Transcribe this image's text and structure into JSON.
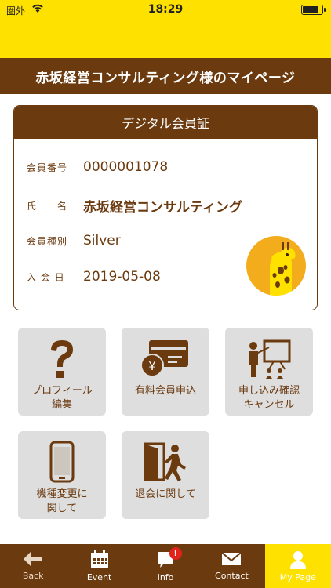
{
  "status_bar": {
    "carrier": "圏外",
    "time": "18:29"
  },
  "header": {
    "title": "赤坂経営コンサルティング様のマイページ"
  },
  "card": {
    "title": "デジタル会員証",
    "rows": [
      {
        "label": "会員番号",
        "value": "0000001078"
      },
      {
        "label": "氏　　名",
        "value": "赤坂経営コンサルティング"
      },
      {
        "label": "会員種別",
        "value": "Silver"
      },
      {
        "label": "入 会 日",
        "value": "2019-05-08"
      }
    ]
  },
  "tiles": [
    {
      "label": "プロフィール\n編集",
      "icon": "question-icon"
    },
    {
      "label": "有料会員申込",
      "icon": "yen-card-icon"
    },
    {
      "label": "申し込み確認\nキャンセル",
      "icon": "presentation-icon"
    },
    {
      "label": "機種変更に\n関して",
      "icon": "smartphone-icon"
    },
    {
      "label": "退会に関して",
      "icon": "exit-door-icon"
    }
  ],
  "tabs": [
    {
      "label": "Back",
      "icon": "back-arrow-icon"
    },
    {
      "label": "Event",
      "icon": "calendar-icon"
    },
    {
      "label": "Info",
      "icon": "chat-bubble-icon",
      "badge": "!"
    },
    {
      "label": "Contact",
      "icon": "mail-icon"
    },
    {
      "label": "My Page",
      "icon": "user-icon"
    }
  ],
  "colors": {
    "brand_brown": "#6b3a0f",
    "brand_yellow": "#ffe100",
    "tile_gray": "#dedede",
    "badge_red": "#e2231a"
  }
}
